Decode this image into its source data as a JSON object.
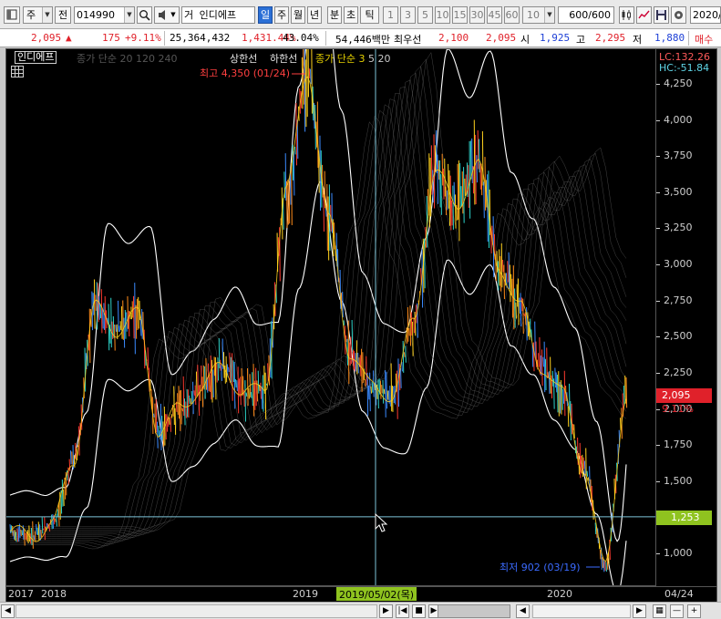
{
  "toolbar": {
    "period_type": "주",
    "prev_button": "전",
    "stock_code": "014990",
    "stock_name_prefix": "거",
    "stock_name": "인디에프",
    "period_buttons": [
      "일",
      "주",
      "월",
      "년",
      "분",
      "초",
      "틱"
    ],
    "selected_period": "일",
    "interval_buttons": [
      "1",
      "3",
      "5",
      "10",
      "15",
      "30",
      "45",
      "60"
    ],
    "interval_value": "10",
    "count_value": "600",
    "count_total": "/600",
    "date_value": "2020/"
  },
  "quote": {
    "price": "2,095",
    "change_arrow": "▲",
    "change": "175",
    "change_rate": "+9.11%",
    "volume": "25,364,432",
    "volume_rate": "1,431.44%",
    "turnover_rate": "43.04%",
    "trade_amount": "54,446백만",
    "best_offer_label": "최우선",
    "best_offer": "2,100",
    "best_bid": "2,095",
    "open_label": "시",
    "open": "1,925",
    "high_label": "고",
    "high": "2,295",
    "low_label": "저",
    "low": "1,880",
    "sell_label": "매수"
  },
  "legend": {
    "name": "인디에프",
    "ma_label": "종가 단순 20",
    "ma_periods": "120 240",
    "envelope_upper": "상한선",
    "envelope_lower": "하한선",
    "ma2_label": "종가 단순 3",
    "ma2_periods": "5 20"
  },
  "annotations": {
    "high": "최고 4,350 (01/24)",
    "low": "최저 902 (03/19)",
    "lc": "LC:132.26",
    "hc": "HC:-51.84",
    "current_price": "2,095",
    "current_rate": "9.11%",
    "crosshair_price": "1,253",
    "crosshair_date": "2019/05/02(목)"
  },
  "price_axis": {
    "ticks": [
      "4,250",
      "4,000",
      "3,750",
      "3,500",
      "3,250",
      "3,000",
      "2,750",
      "2,500",
      "2,250",
      "2,000",
      "1,750",
      "1,500",
      "1,250",
      "1,000"
    ]
  },
  "date_axis": {
    "labels": [
      "2017",
      "2018",
      "2019",
      "2020"
    ],
    "right_label": "04/24"
  },
  "colors": {
    "chart_bg": "#000000",
    "up_candle": "#ff3b30",
    "down_candle": "#3b8bff",
    "ma_white": "#ffffff",
    "crosshair": "#7ec4d8",
    "selected_blue": "#2a6fd6",
    "price_badge_red": "#e0212a",
    "crosshair_badge_green": "#8fc31f"
  },
  "chart_data": {
    "type": "line",
    "title": "인디에프",
    "series": [
      {
        "name": "인디에프",
        "x": [
          "2017-09",
          "2017-11",
          "2018-01",
          "2018-02",
          "2018-03",
          "2018-04",
          "2018-05",
          "2018-06",
          "2018-07",
          "2018-08",
          "2018-09",
          "2018-10",
          "2018-11",
          "2018-12",
          "2019-01",
          "2019-02",
          "2019-03",
          "2019-04",
          "2019-05",
          "2019-06",
          "2019-07",
          "2019-08",
          "2019-09",
          "2019-10",
          "2019-11",
          "2019-12",
          "2020-01",
          "2020-02",
          "2020-03",
          "2020-04"
        ],
        "values": [
          1150,
          1120,
          1200,
          1650,
          2700,
          2550,
          2650,
          1850,
          2000,
          2150,
          2300,
          2100,
          2150,
          3500,
          4350,
          3300,
          2400,
          2150,
          2100,
          2600,
          3650,
          3400,
          3700,
          3000,
          2700,
          2300,
          2100,
          1600,
          902,
          2095
        ]
      }
    ],
    "ylim": [
      800,
      4400
    ],
    "grid": false,
    "high": {
      "value": 4350,
      "date": "01/24"
    },
    "low": {
      "value": 902,
      "date": "03/19"
    }
  }
}
